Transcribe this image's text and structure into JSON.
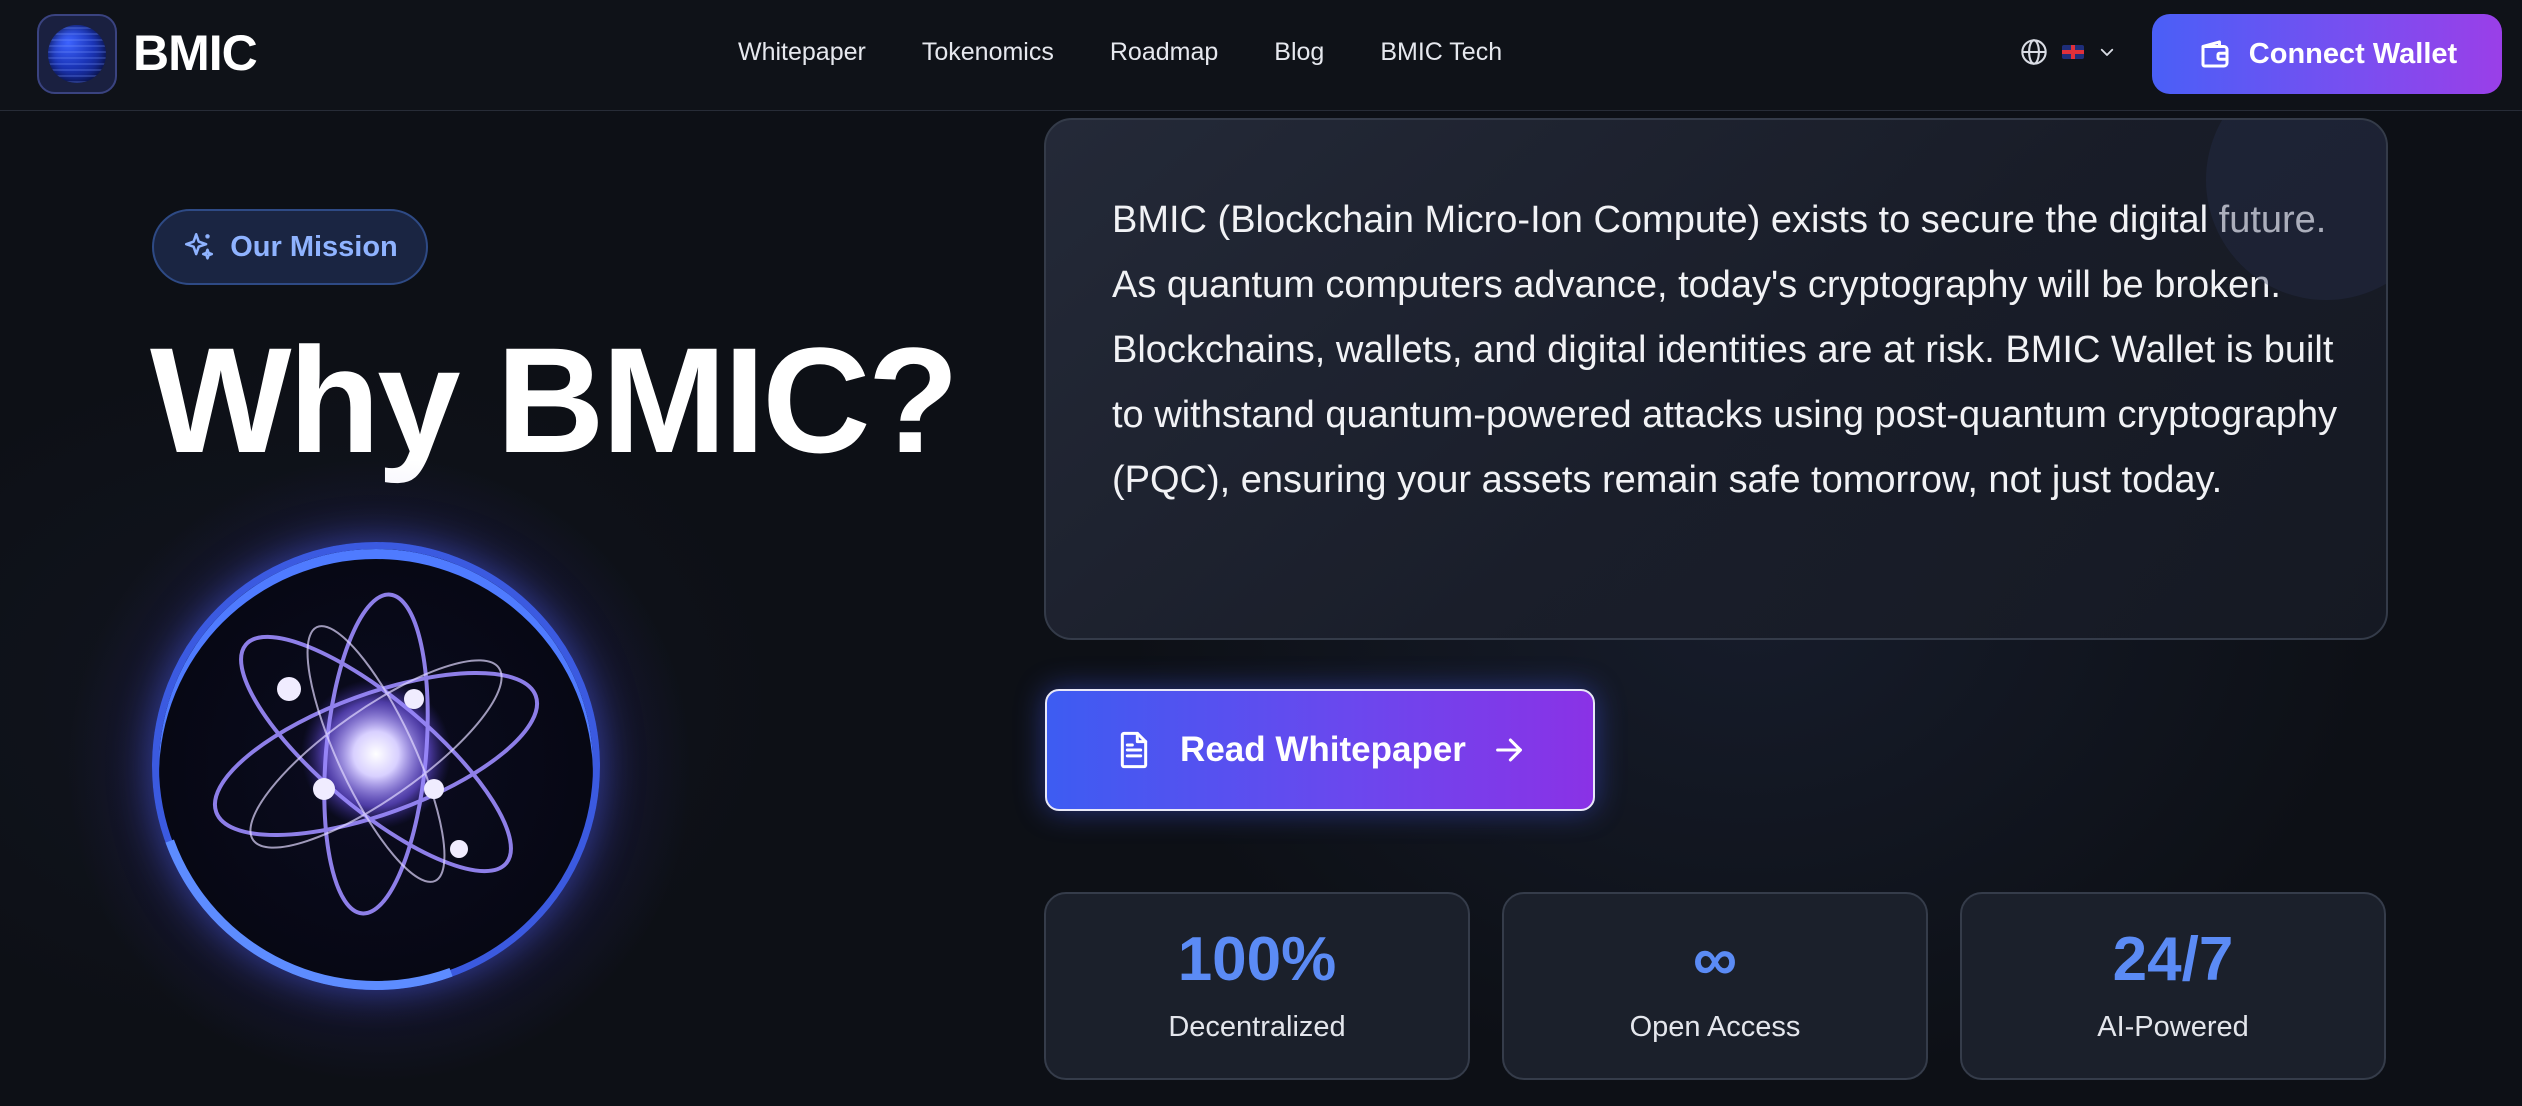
{
  "header": {
    "brand": "BMIC",
    "nav": [
      "Whitepaper",
      "Tokenomics",
      "Roadmap",
      "Blog",
      "BMIC Tech"
    ],
    "connect_label": "Connect Wallet"
  },
  "hero": {
    "pill_label": "Our Mission",
    "headline": "Why BMIC?"
  },
  "mission": {
    "text": "BMIC (Blockchain Micro-Ion Compute) exists to secure the digital future. As quantum computers advance, today's cryptography will be broken. Blockchains, wallets, and digital identities are at risk. BMIC Wallet is built to withstand quantum-powered attacks using post-quantum cryptography (PQC), ensuring your assets remain safe tomorrow, not just today.",
    "cta_label": "Read Whitepaper"
  },
  "stats": [
    {
      "value": "100%",
      "label": "Decentralized"
    },
    {
      "value": "∞",
      "label": "Open Access"
    },
    {
      "value": "24/7",
      "label": "AI-Powered"
    }
  ],
  "icons": {
    "language": "globe-icon",
    "flag": "uk-flag-icon",
    "dropdown": "chevron-down-icon",
    "wallet": "wallet-icon",
    "sparkles": "sparkles-icon",
    "document": "document-icon",
    "arrow": "arrow-right-icon"
  },
  "colors": {
    "accent_blue": "#5b8bf5",
    "gradient_start": "#4a5ff7",
    "gradient_end": "#9a3fe8",
    "background": "#0d1016"
  }
}
